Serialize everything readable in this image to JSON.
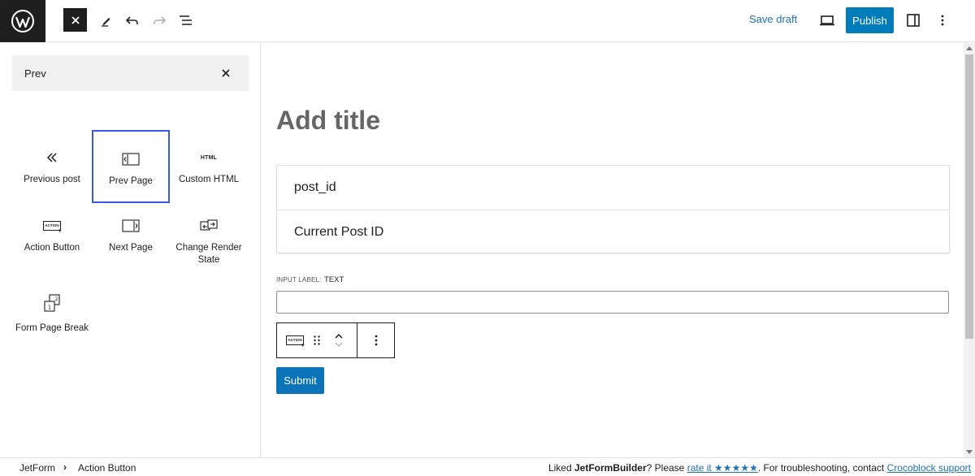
{
  "header": {
    "save_draft": "Save draft",
    "publish": "Publish",
    "icons": [
      "wordpress-logo",
      "close-icon",
      "pencil-icon",
      "undo-icon",
      "redo-icon",
      "list-view-icon",
      "desktop-preview-icon",
      "sidebar-toggle-icon",
      "more-options-icon"
    ]
  },
  "inserter": {
    "search_value": "Prev",
    "blocks": [
      {
        "label": "Previous post",
        "icon": "chevrons-left-icon"
      },
      {
        "label": "Prev Page",
        "icon": "prev-page-icon",
        "selected": true
      },
      {
        "label": "Custom HTML",
        "icon": "html-icon",
        "icon_text": "HTML"
      },
      {
        "label": "Action Button",
        "icon": "action-button-icon",
        "icon_text": "ACTION"
      },
      {
        "label": "Next Page",
        "icon": "next-page-icon"
      },
      {
        "label": "Change Render State",
        "icon": "change-render-state-icon"
      },
      {
        "label": "Form Page Break",
        "icon": "form-page-break-icon",
        "icon_text": "1 2"
      }
    ]
  },
  "editor": {
    "title_placeholder": "Add title",
    "options": [
      "post_id",
      "Current Post ID"
    ],
    "input_label": "INPUT LABEL:",
    "input_type": "TEXT",
    "toolbar_icon_text": "ACTION",
    "submit_label": "Submit"
  },
  "footer": {
    "breadcrumb": [
      "JetForm",
      "Action Button"
    ],
    "separator": "›",
    "note_prefix": "Liked ",
    "note_brand": "JetFormBuilder",
    "note_middle": "? Please ",
    "rate_link": "rate it ★★★★★",
    "note_after_rate": ". For troubleshooting, contact ",
    "support_link": "Crocoblock support"
  },
  "colors": {
    "accent": "#007cba",
    "link": "#2271b1",
    "selected_border": "#3858e9",
    "dark": "#1e1e1e"
  }
}
